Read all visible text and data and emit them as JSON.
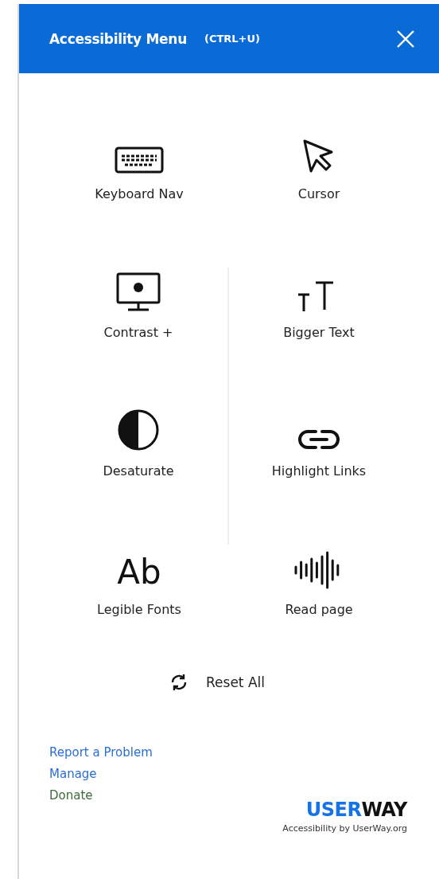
{
  "header": {
    "title": "Accessibility Menu",
    "shortcut": "(CTRL+U)"
  },
  "tiles": [
    {
      "kind": "keyboard",
      "label": "Keyboard Nav"
    },
    {
      "kind": "cursor",
      "label": "Cursor"
    },
    {
      "kind": "contrast",
      "label": "Contrast +"
    },
    {
      "kind": "bigger-text",
      "label": "Bigger Text"
    },
    {
      "kind": "desaturate",
      "label": "Desaturate"
    },
    {
      "kind": "link",
      "label": "Highlight Links"
    },
    {
      "kind": "glyph",
      "glyph": "Ab",
      "label": "Legible Fonts"
    },
    {
      "kind": "sound",
      "label": "Read page"
    }
  ],
  "reset": {
    "label": "Reset All"
  },
  "links": [
    {
      "label": "Report a Problem",
      "color": "#2a6fd6"
    },
    {
      "label": "Manage",
      "color": "#2a6fd6"
    },
    {
      "label": "Donate",
      "color": "#3f6b3a"
    }
  ],
  "brand": {
    "logo_first": "USER",
    "logo_second": "WAY",
    "tagline": "Accessibility by UserWay.org"
  }
}
